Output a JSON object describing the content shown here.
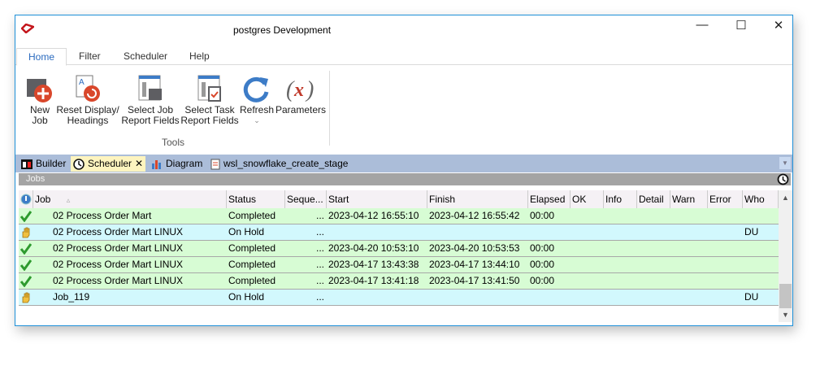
{
  "window": {
    "title": "postgres  Development",
    "minimize": "—",
    "maximize": "☐",
    "close": "✕"
  },
  "ribbon_tabs": [
    "Home",
    "Filter",
    "Scheduler",
    "Help"
  ],
  "ribbon": {
    "buttons": [
      {
        "label1": "New",
        "label2": "Job"
      },
      {
        "label1": "Reset Display/",
        "label2": "Headings"
      },
      {
        "label1": "Select Job",
        "label2": "Report Fields"
      },
      {
        "label1": "Select Task",
        "label2": "Report Fields"
      },
      {
        "label1": "Refresh",
        "label2": "⌄"
      },
      {
        "label1": "Parameters",
        "label2": ""
      }
    ],
    "group": "Tools"
  },
  "doc_tabs": [
    "Builder",
    "Scheduler",
    "Diagram",
    "wsl_snowflake_create_stage"
  ],
  "doc_tab_close": "✕",
  "panel_title": "Jobs",
  "columns": [
    "",
    "Job",
    "Status",
    "Seque...",
    "Start",
    "Finish",
    "Elapsed",
    "OK",
    "Info",
    "Detail",
    "Warn",
    "Error",
    "Who"
  ],
  "sort_indicator": "▵",
  "rows": [
    {
      "type": "c",
      "job": "02 Process Order Mart",
      "status": "Completed",
      "seq": "...",
      "start": "2023-04-12 16:55:10",
      "finish": "2023-04-12 16:55:42",
      "elapsed": "00:00",
      "who": ""
    },
    {
      "type": "h",
      "job": "02 Process Order Mart LINUX",
      "status": "On Hold",
      "seq": "...",
      "start": "",
      "finish": "",
      "elapsed": "",
      "who": "DU"
    },
    {
      "type": "c",
      "job": "02 Process Order Mart LINUX",
      "status": "Completed",
      "seq": "...",
      "start": "2023-04-20 10:53:10",
      "finish": "2023-04-20 10:53:53",
      "elapsed": "00:00",
      "who": ""
    },
    {
      "type": "c",
      "job": "02 Process Order Mart LINUX",
      "status": "Completed",
      "seq": "...",
      "start": "2023-04-17 13:43:38",
      "finish": "2023-04-17 13:44:10",
      "elapsed": "00:00",
      "who": ""
    },
    {
      "type": "c",
      "job": "02 Process Order Mart LINUX",
      "status": "Completed",
      "seq": "...",
      "start": "2023-04-17 13:41:18",
      "finish": "2023-04-17 13:41:50",
      "elapsed": "00:00",
      "who": ""
    },
    {
      "type": "h",
      "job": "Job_119",
      "status": "On Hold",
      "seq": "...",
      "start": "",
      "finish": "",
      "elapsed": "",
      "who": "DU"
    }
  ]
}
